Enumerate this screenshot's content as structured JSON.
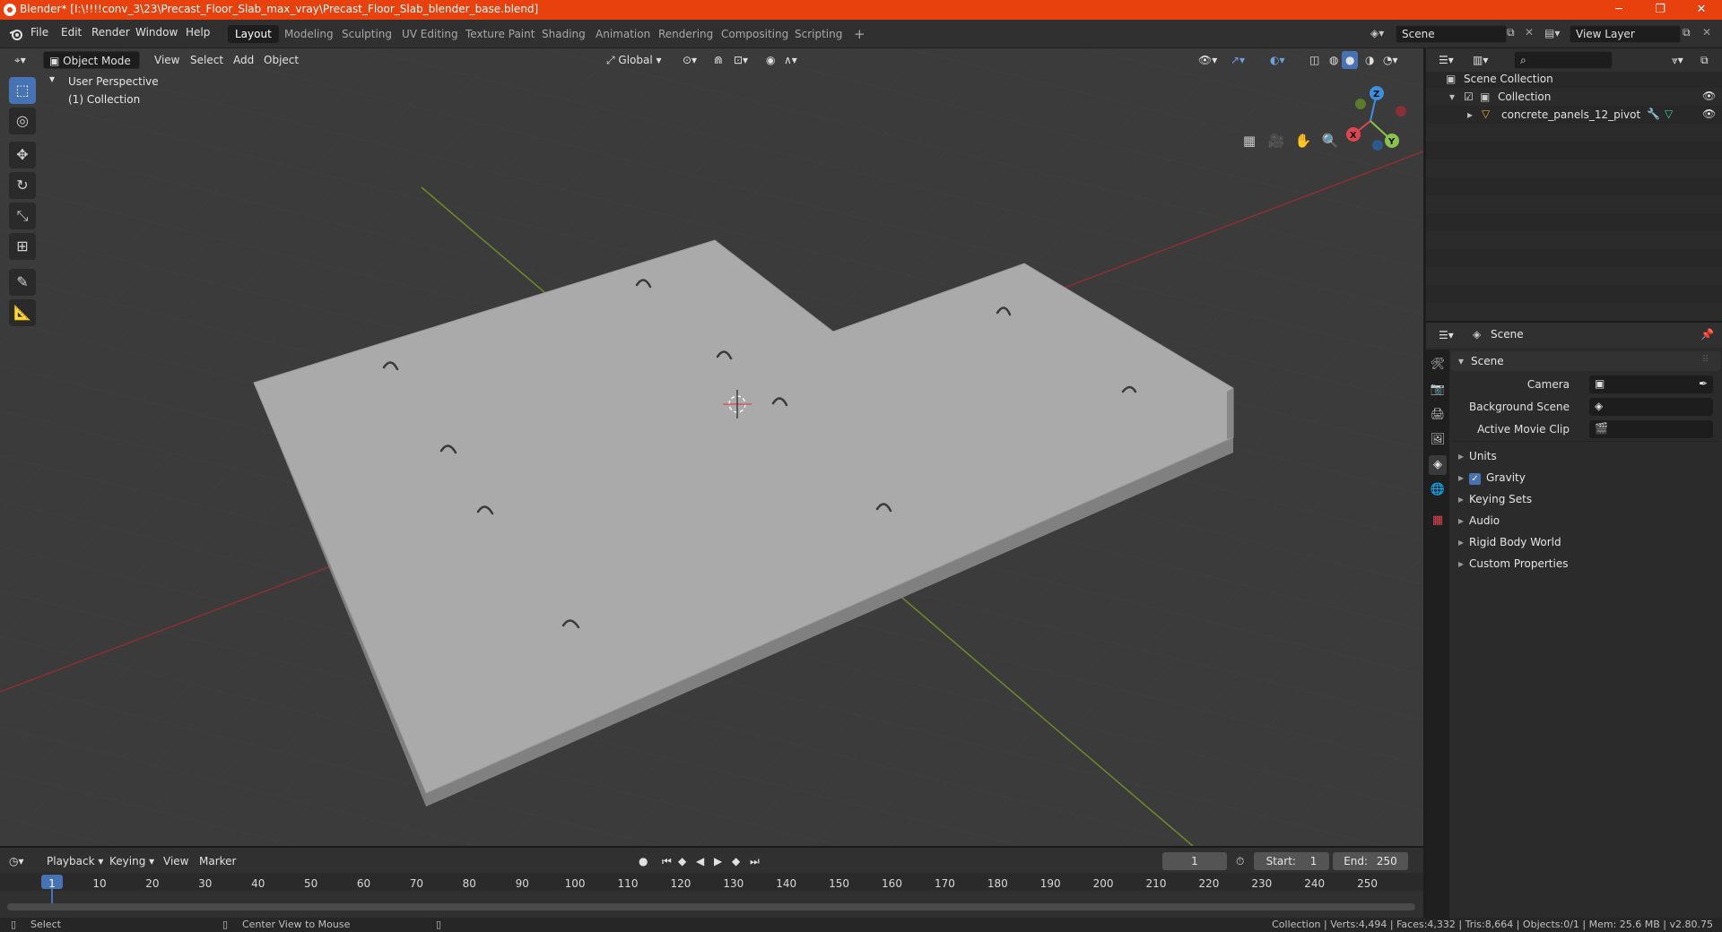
{
  "titlebar": {
    "title": "Blender* [I:\\!!!!conv_3\\23\\Precast_Floor_Slab_max_vray\\Precast_Floor_Slab_blender_base.blend]",
    "minimize": "─",
    "maximize": "❐",
    "close": "✕"
  },
  "menu": [
    "File",
    "Edit",
    "Render",
    "Window",
    "Help"
  ],
  "workspaces": [
    "Layout",
    "Modeling",
    "Sculpting",
    "UV Editing",
    "Texture Paint",
    "Shading",
    "Animation",
    "Rendering",
    "Compositing",
    "Scripting"
  ],
  "workspace_add": "+",
  "scene_field": "Scene",
  "view_layer_field": "View Layer",
  "viewport": {
    "mode": "Object Mode",
    "menus": [
      "View",
      "Select",
      "Add",
      "Object"
    ],
    "transform_orientation": "Global",
    "perspective_label": "User Perspective",
    "collection_label": "(1) Collection",
    "gizmo": {
      "x": "X",
      "y": "Y",
      "z": "Z"
    }
  },
  "outliner": {
    "scene_collection": "Scene Collection",
    "collection": "Collection",
    "object": "concrete_panels_12_pivot"
  },
  "properties": {
    "header_title": "Scene",
    "panel_title": "Scene",
    "camera_label": "Camera",
    "background_scene_label": "Background Scene",
    "active_movie_clip_label": "Active Movie Clip",
    "sections": [
      "Units",
      "Gravity",
      "Keying Sets",
      "Audio",
      "Rigid Body World",
      "Custom Properties"
    ],
    "gravity_checked": true
  },
  "timeline": {
    "menus": [
      "Playback",
      "Keying",
      "View",
      "Marker"
    ],
    "current_frame": "1",
    "start": "Start:",
    "start_value": "1",
    "end": "End:",
    "end_value": "250",
    "ruler": [
      "1",
      "10",
      "20",
      "30",
      "40",
      "50",
      "60",
      "70",
      "80",
      "90",
      "100",
      "110",
      "120",
      "130",
      "140",
      "150",
      "160",
      "170",
      "180",
      "190",
      "200",
      "210",
      "220",
      "230",
      "240",
      "250"
    ]
  },
  "statusbar": {
    "select": "Select",
    "center_view": "Center View to Mouse",
    "stats": "Collection | Verts:4,494 | Faces:4,332 | Tris:8,664 | Objects:0/1 | Mem: 25.6 MB | v2.80.75"
  },
  "colors": {
    "titlebar": "#e8410e",
    "accent": "#4772b3",
    "x_axis": "#e0454f",
    "y_axis": "#8bc34a",
    "z_axis": "#3d8fe0"
  }
}
